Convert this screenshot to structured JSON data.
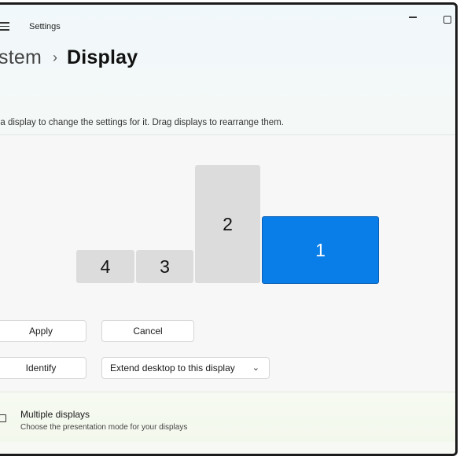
{
  "window": {
    "app_title": "Settings"
  },
  "breadcrumb": {
    "parent": "stem",
    "separator": "›",
    "current": "Display"
  },
  "instruction": "t a display to change the settings for it. Drag displays to rearrange them.",
  "displays": [
    {
      "id": "4",
      "label": "4",
      "selected": false
    },
    {
      "id": "3",
      "label": "3",
      "selected": false
    },
    {
      "id": "2",
      "label": "2",
      "selected": false
    },
    {
      "id": "1",
      "label": "1",
      "selected": true
    }
  ],
  "buttons": {
    "apply": "Apply",
    "cancel": "Cancel",
    "identify": "Identify"
  },
  "display_mode": {
    "selected": "Extend desktop to this display",
    "chevron_icon": "chevron-down-icon"
  },
  "multiple_displays": {
    "title": "Multiple displays",
    "subtitle": "Choose the presentation mode for your displays",
    "icon": "monitor-icon",
    "chevron_icon": "chevron-down-icon"
  },
  "colors": {
    "accent": "#0a7ee8",
    "monitor_inactive": "#dcdcdc"
  }
}
